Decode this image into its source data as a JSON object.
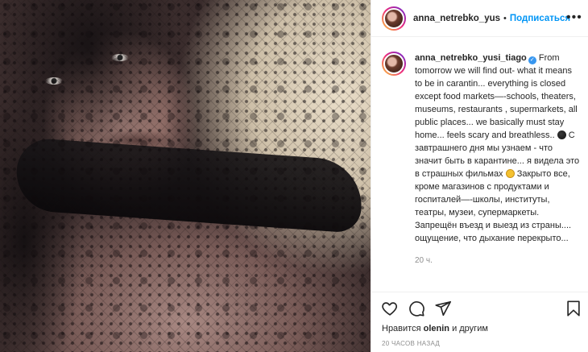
{
  "post": {
    "image_alt": "Фото",
    "header": {
      "username": "anna_netrebko_yus",
      "separator": "•",
      "follow_label": "Подписаться",
      "more_icon": "more-horizontal-icon"
    },
    "caption": {
      "username": "anna_netrebko_yusi_tiago",
      "verified_icon": "verified-badge-icon",
      "text_en_1": "From tomorrow we will find out- what it means to be in carantin... everything is closed except food markets—-schools, theaters, museums, restaurants , supermarkets, all public places... we basically must stay home... feels scary and breathless..",
      "text_ru_1": "С завтрашнего дня мы узнаем - что значит быть в карантине... я видела это в страшных фильмах",
      "text_ru_2": "Закрыто все, кроме магазинов с продуктами и госпиталей—-школы, институты, театры, музеи, супермаркеты. Запрещён въезд и выезд из страны.... ощущение, что дыхание перекрыто...",
      "emoji_1": "new-moon-emoji",
      "emoji_2": "upside-down-face-emoji",
      "time_ago": "20 ч."
    },
    "actions": {
      "like_icon": "heart-icon",
      "comment_icon": "comment-icon",
      "share_icon": "paper-plane-icon",
      "save_icon": "bookmark-icon"
    },
    "likes": {
      "prefix": "Нравится",
      "user": "olenin",
      "suffix": "и другим"
    },
    "posted_ago": "20 ЧАСОВ НАЗАД"
  }
}
